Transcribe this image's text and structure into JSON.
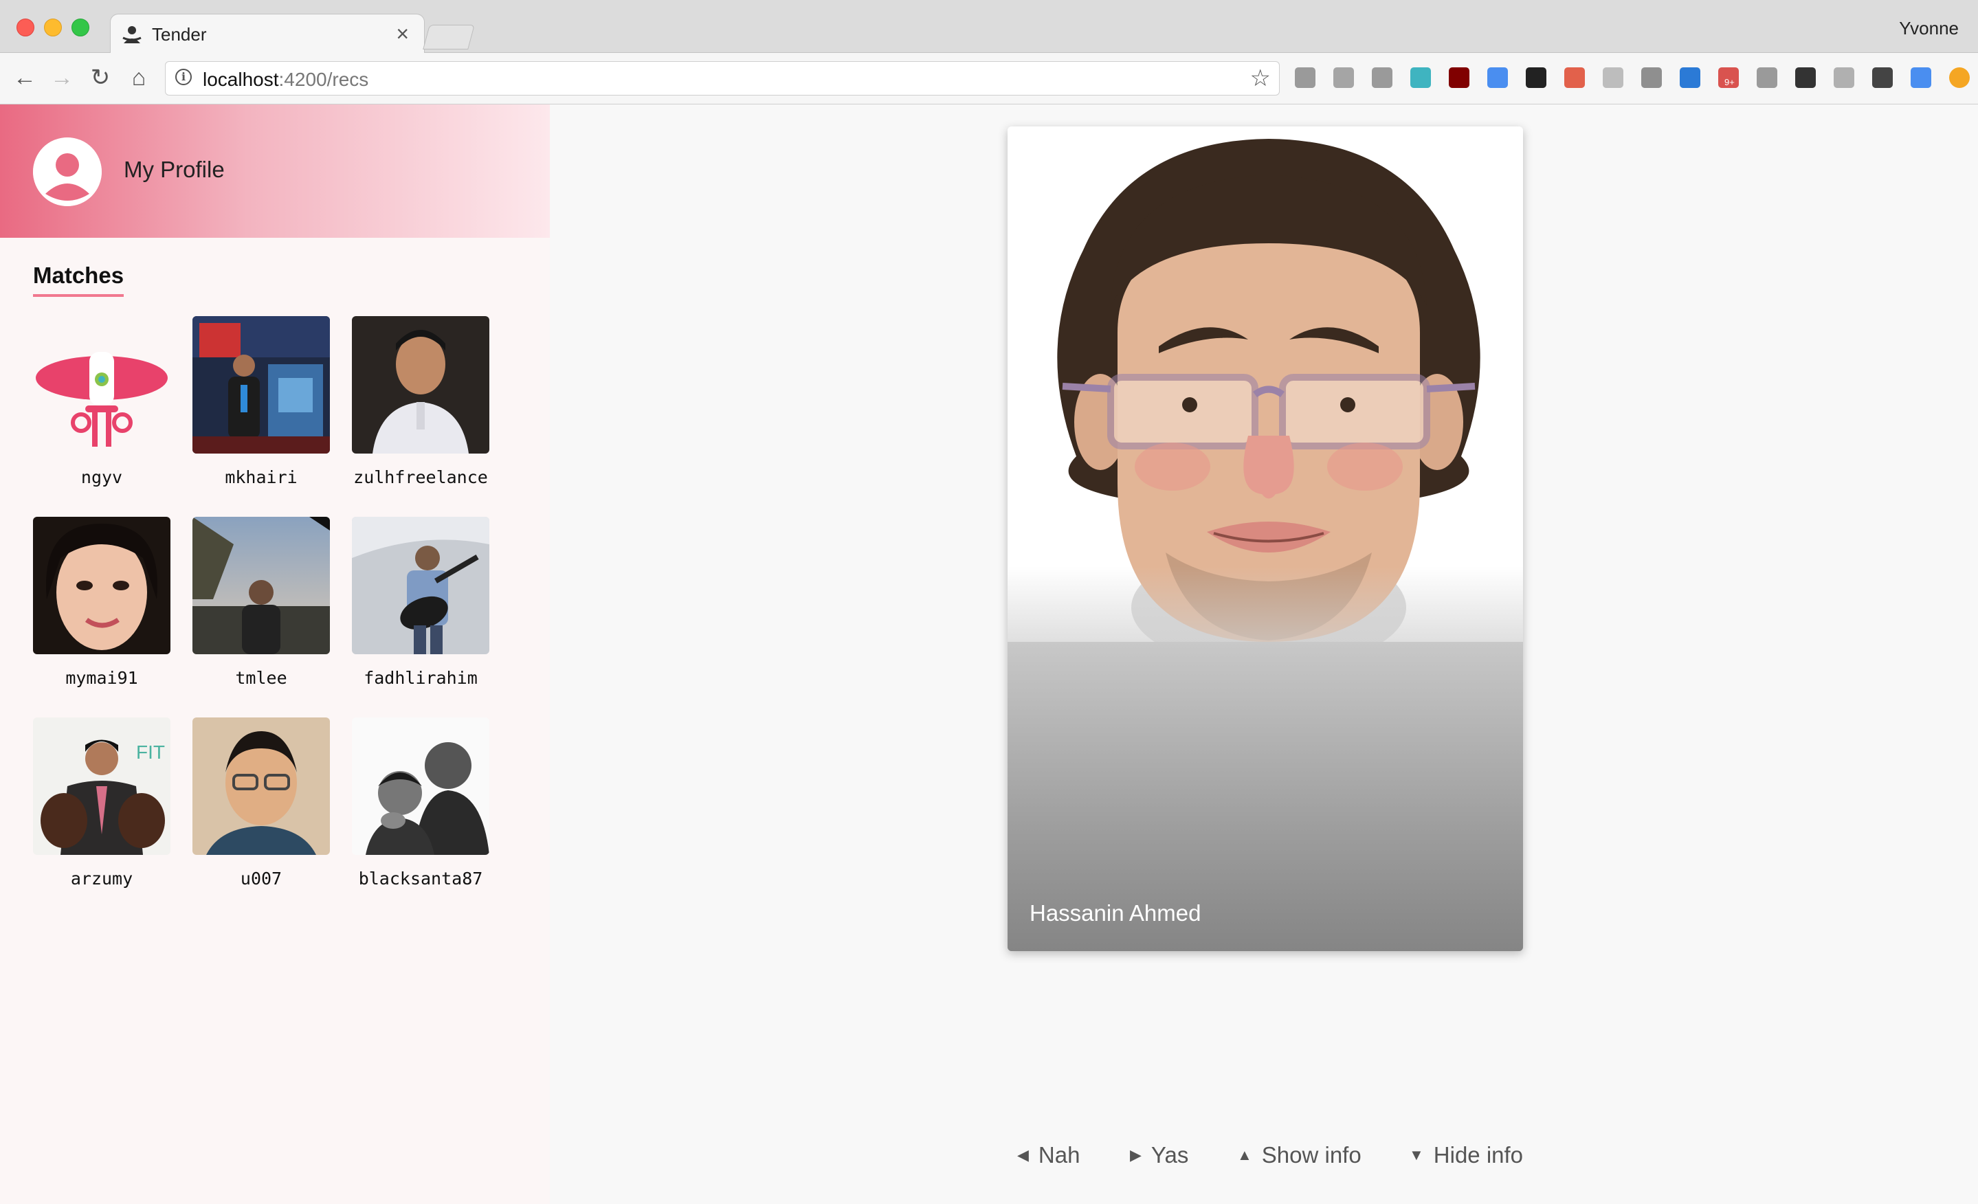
{
  "browser": {
    "tab_title": "Tender",
    "tab_close": "×",
    "user_name": "Yvonne",
    "url_host": "localhost",
    "url_path": ":4200/recs",
    "nav": {
      "back": "←",
      "forward": "→",
      "reload": "↻",
      "home": "⌂"
    },
    "star": "☆",
    "extensions": [
      {
        "name": "bar-chart-icon",
        "color": "#9a9a9a"
      },
      {
        "name": "cloud-icon",
        "color": "#a5a5a5"
      },
      {
        "name": "braces-icon",
        "color": "#9a9a9a"
      },
      {
        "name": "teal-m-icon",
        "color": "#3fb4c0"
      },
      {
        "name": "ublock-icon",
        "color": "#800000"
      },
      {
        "name": "eyedropper-icon",
        "color": "#4a8ef0"
      },
      {
        "name": "d-icon",
        "color": "#222222"
      },
      {
        "name": "shield-icon",
        "color": "#e2614b"
      },
      {
        "name": "react-icon",
        "color": "#bdbdbd"
      },
      {
        "name": "cb-icon",
        "color": "#8f8f8f"
      },
      {
        "name": "book-icon",
        "color": "#2b7ad6"
      },
      {
        "name": "globe-badge-icon",
        "color": "#d9534f"
      },
      {
        "name": "slash-icon",
        "color": "#9a9a9a"
      },
      {
        "name": "bracket-icon",
        "color": "#333333"
      },
      {
        "name": "tree-icon",
        "color": "#b0b0b0"
      },
      {
        "name": "w-icon",
        "color": "#444444"
      },
      {
        "name": "translate-icon",
        "color": "#4a8ef0"
      },
      {
        "name": "alert-icon",
        "color": "#f5a623"
      }
    ],
    "badge": "9+"
  },
  "sidebar": {
    "profile_label": "My Profile",
    "matches_title": "Matches",
    "matches": [
      {
        "name": "ngyv"
      },
      {
        "name": "mkhairi"
      },
      {
        "name": "zulhfreelance"
      },
      {
        "name": "mymai91"
      },
      {
        "name": "tmlee"
      },
      {
        "name": "fadhlirahim"
      },
      {
        "name": "arzumy"
      },
      {
        "name": "u007"
      },
      {
        "name": "blacksanta87"
      }
    ]
  },
  "card": {
    "name": "Hassanin Ahmed"
  },
  "actions": {
    "nah": "Nah",
    "yas": "Yas",
    "show_info": "Show info",
    "hide_info": "Hide info",
    "nah_icon": "◀",
    "yas_icon": "▶",
    "show_icon": "▲",
    "hide_icon": "▼"
  },
  "colors": {
    "accent": "#f0788f",
    "header_start": "#e96a82",
    "header_end": "#fde8ec"
  }
}
